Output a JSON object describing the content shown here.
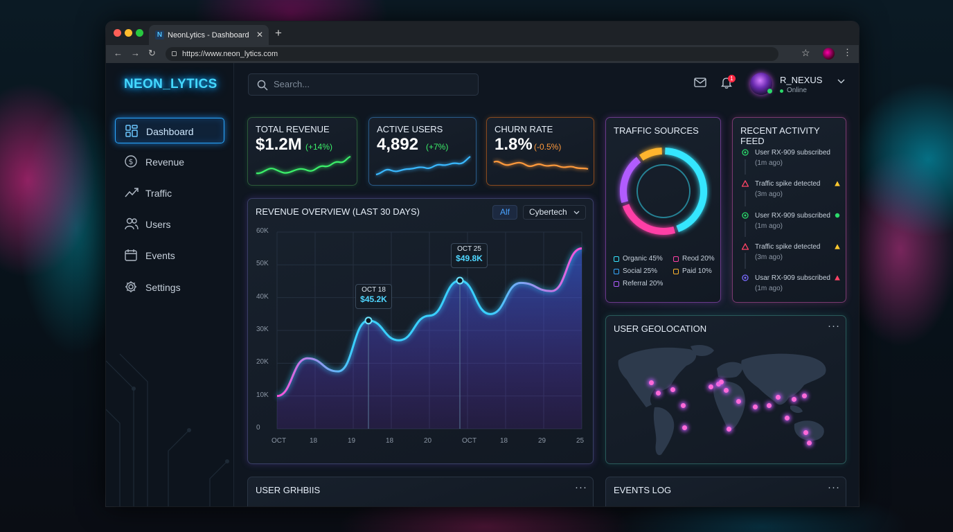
{
  "browser": {
    "tab_title": "NeonLytics - Dashboard",
    "favicon_letter": "N",
    "url": "https://www.neon_lytics.com"
  },
  "sidebar": {
    "logo": "NEON_LYTICS",
    "items": [
      {
        "label": "Dashboard",
        "icon": "dashboard-icon"
      },
      {
        "label": "Revenue",
        "icon": "dollar-icon"
      },
      {
        "label": "Traffic",
        "icon": "trend-icon"
      },
      {
        "label": "Users",
        "icon": "users-icon"
      },
      {
        "label": "Events",
        "icon": "calendar-icon"
      },
      {
        "label": "Settings",
        "icon": "gear-icon"
      }
    ]
  },
  "header": {
    "search_placeholder": "Search...",
    "notification_count": "1",
    "user_name": "R_NEXUS",
    "user_status": "Online"
  },
  "kpis": [
    {
      "label": "TOTAL REVENUE",
      "value": "$1.2M",
      "delta": "(+14%)",
      "color": "#3cf06a"
    },
    {
      "label": "ACTIVE USERS",
      "value": "4,892",
      "delta": "(+7%)",
      "color": "#3ab8ff"
    },
    {
      "label": "CHURN RATE",
      "value": "1.8%",
      "delta": "(-0.5%)",
      "color": "#ff9a3c"
    }
  ],
  "revenue": {
    "title": "REVENUE OVERVIEW (LAST 30 DAYS)",
    "filter_all": "Alf",
    "filter_select": "Cybertech",
    "y_ticks": [
      "60K",
      "50K",
      "40K",
      "30K",
      "20K",
      "10K",
      "0"
    ],
    "x_ticks": [
      "OCT",
      "18",
      "19",
      "18",
      "20",
      "OCT",
      "18",
      "29",
      "25"
    ],
    "tooltip1": {
      "date": "OCT 18",
      "value": "$45.2K"
    },
    "tooltip2": {
      "date": "OCT 25",
      "value": "$49.8K"
    }
  },
  "chart_data": {
    "type": "area",
    "x": [
      "OCT",
      "18",
      "19",
      "18",
      "20",
      "OCT",
      "18",
      "29",
      "25"
    ],
    "series": [
      {
        "values": [
          10000,
          21500,
          17500,
          33000,
          27000,
          34500,
          45200,
          35000,
          44500,
          42000,
          55000
        ]
      }
    ],
    "ylim": [
      0,
      60000
    ],
    "grid": true
  },
  "traffic": {
    "title": "TRAFFIC SOURCES",
    "slices": [
      {
        "label": "Organic 45%",
        "value": 45,
        "color": "#35e6ff"
      },
      {
        "label": "Social 25%",
        "value": 25,
        "color": "#ff3fa6"
      },
      {
        "label": "Referral 20%",
        "value": 20,
        "color": "#b15cff"
      },
      {
        "label": "Paid 10%",
        "value": 10,
        "color": "#ffb52e"
      }
    ],
    "legend": [
      "Organic 45%",
      "Reod 20%",
      "Social 25%",
      "Paid 10%",
      "Referral 20%"
    ]
  },
  "feed": {
    "title": "RECENT ACTIVITY FEED",
    "items": [
      {
        "text": "User RX-909 subscribed",
        "time": "(1m ago)"
      },
      {
        "text": "Traffic spike detected",
        "time": "(3m ago)"
      },
      {
        "text": "User RX-909 subscribed",
        "time": "(1m ago)"
      },
      {
        "text": "Traffic spike detected",
        "time": "(3m ago)"
      },
      {
        "text": "Usar RX-909 subscribed",
        "time": "(1m ago)"
      }
    ]
  },
  "geo": {
    "title": "USER GEOLOCATION"
  },
  "bottom": {
    "left_title": "USER GRHBIIS",
    "right_title": "EVENTS LOG"
  }
}
